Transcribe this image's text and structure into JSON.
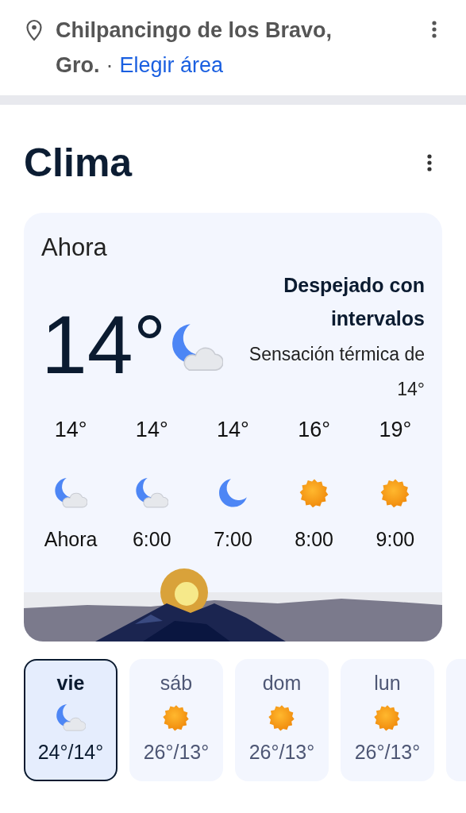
{
  "location": {
    "place": "Chilpancingo de los Bravo, Gro.",
    "separator": "·",
    "link": "Elegir área"
  },
  "weather": {
    "title": "Clima",
    "current": {
      "label": "Ahora",
      "temperature": "14°",
      "kind": "moon-cloud",
      "description": "Despejado con intervalos",
      "feels_like": "Sensación térmica de 14°"
    },
    "hourly": [
      {
        "temperature": "14°",
        "kind": "moon-cloud",
        "time": "Ahora"
      },
      {
        "temperature": "14°",
        "kind": "moon-cloud",
        "time": "6:00"
      },
      {
        "temperature": "14°",
        "kind": "moon",
        "time": "7:00"
      },
      {
        "temperature": "16°",
        "kind": "sun",
        "time": "8:00"
      },
      {
        "temperature": "19°",
        "kind": "sun",
        "time": "9:00"
      }
    ],
    "days": [
      {
        "day": "vie",
        "kind": "moon-cloud",
        "range": "24°/14°",
        "selected": true
      },
      {
        "day": "sáb",
        "kind": "sun",
        "range": "26°/13°",
        "selected": false
      },
      {
        "day": "dom",
        "kind": "sun",
        "range": "26°/13°",
        "selected": false
      },
      {
        "day": "lun",
        "kind": "sun",
        "range": "26°/13°",
        "selected": false
      }
    ]
  }
}
